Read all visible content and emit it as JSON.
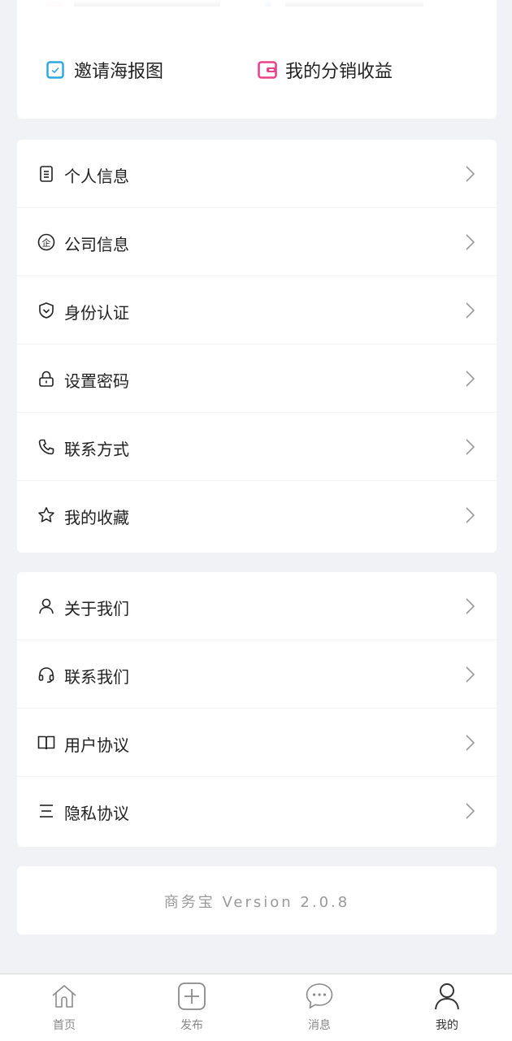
{
  "quick_actions": {
    "items": [
      {
        "label": "邀请海报图",
        "icon": "poster-icon",
        "color": "#2aa7e0"
      },
      {
        "label": "我的分销收益",
        "icon": "wallet-icon",
        "color": "#e8448c"
      }
    ]
  },
  "account_menu": {
    "items": [
      {
        "label": "个人信息",
        "icon": "document-icon"
      },
      {
        "label": "公司信息",
        "icon": "enterprise-icon"
      },
      {
        "label": "身份认证",
        "icon": "shield-icon"
      },
      {
        "label": "设置密码",
        "icon": "lock-icon"
      },
      {
        "label": "联系方式",
        "icon": "phone-icon"
      },
      {
        "label": "我的收藏",
        "icon": "star-icon"
      }
    ]
  },
  "info_menu": {
    "items": [
      {
        "label": "关于我们",
        "icon": "user-icon"
      },
      {
        "label": "联系我们",
        "icon": "headset-icon"
      },
      {
        "label": "用户协议",
        "icon": "book-icon"
      },
      {
        "label": "隐私协议",
        "icon": "list-icon"
      }
    ]
  },
  "version": "商务宝 Version 2.0.8",
  "tabbar": {
    "tabs": [
      {
        "label": "首页",
        "icon": "home-icon",
        "active": false
      },
      {
        "label": "发布",
        "icon": "add-icon",
        "active": false
      },
      {
        "label": "消息",
        "icon": "chat-icon",
        "active": false
      },
      {
        "label": "我的",
        "icon": "profile-icon",
        "active": true
      }
    ]
  }
}
